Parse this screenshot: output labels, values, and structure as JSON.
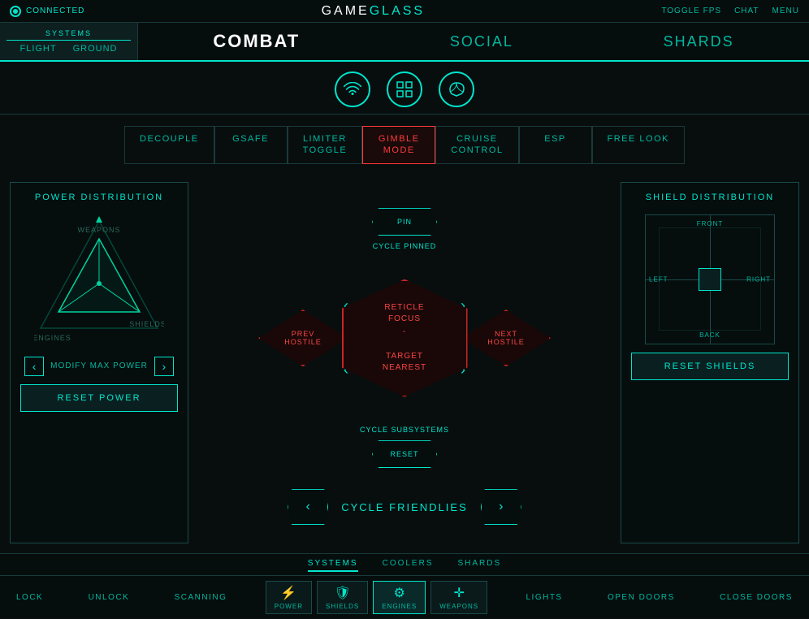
{
  "topbar": {
    "connected": "CONNECTED",
    "title_game": "GAME",
    "title_glass": "GLASS",
    "toggle_fps": "TOGGLE FPS",
    "chat": "CHAT",
    "menu": "MENU"
  },
  "nav": {
    "systems_label": "SYSTEMS",
    "flight": "FLIGHT",
    "ground": "GROUND",
    "combat": "COMBAT",
    "social": "SOCIAL",
    "shards": "SHARDS"
  },
  "icons": {
    "wifi": "⌾",
    "grid": "⊞",
    "leaf": "❧"
  },
  "toggles": [
    {
      "label": "DECOUPLE",
      "active": false
    },
    {
      "label": "GSAFE",
      "active": false
    },
    {
      "label": "LIMITER\nTOGGLE",
      "active": false
    },
    {
      "label": "GIMBLE\nMODE",
      "active": true
    },
    {
      "label": "CRUISE\nCONTROL",
      "active": false
    },
    {
      "label": "ESP",
      "active": false
    },
    {
      "label": "FREE LOOK",
      "active": false
    }
  ],
  "left_panel": {
    "title": "POWER DISTRIBUTION",
    "modify_label": "MODIFY MAX POWER",
    "reset_label": "RESET POWER",
    "triangle_labels": [
      "WEAPONS",
      "SHIELDS",
      "ENGINES"
    ]
  },
  "center": {
    "pin": "PIN",
    "cycle_pinned": "CYCLE PINNED",
    "reticle_focus": "RETICLE\nFOCUS",
    "dash": "-",
    "target_nearest": "TARGET\nNEAREST",
    "prev_hostile": "PREV\nHOSTILE",
    "next_hostile": "NEXT\nHOSTILE",
    "cycle_subsystems": "CYCLE SUBSYSTEMS",
    "reset": "RESET",
    "cycle_friendlies": "CYCLE FRIENDLIES"
  },
  "right_panel": {
    "title": "SHIELD DISTRIBUTION",
    "reset_label": "RESET SHIELDS",
    "labels": {
      "front": "FRONT",
      "back": "BACK",
      "left": "LEFT",
      "right": "RIGHT"
    }
  },
  "bottom": {
    "tabs": [
      "SYSTEMS",
      "COOLERS",
      "SHARDS"
    ],
    "active_tab": "SYSTEMS",
    "actions": [
      "LOCK",
      "UNLOCK",
      "SCANNING",
      "LIGHTS",
      "OPEN DOORS",
      "CLOSE DOORS"
    ],
    "icons": [
      {
        "label": "POWER",
        "sym": "⚡"
      },
      {
        "label": "SHIELDS",
        "sym": "🛡"
      },
      {
        "label": "ENGINES",
        "sym": "⚙"
      },
      {
        "label": "WEAPONS",
        "sym": "⊕"
      }
    ],
    "active_icon": "ENGINES"
  }
}
